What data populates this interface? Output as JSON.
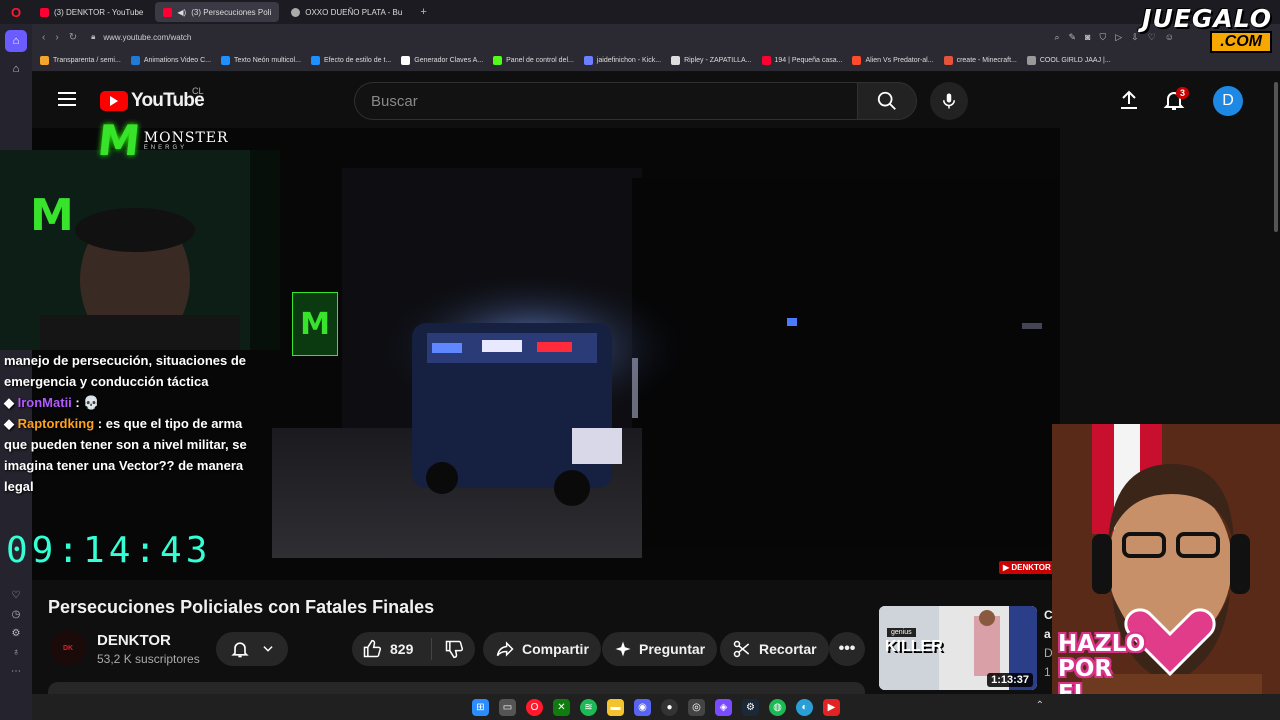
{
  "browser": {
    "tabs": [
      {
        "label": "(3) DENKTOR - YouTube",
        "active": false
      },
      {
        "label": "(3) Persecuciones Poli",
        "active": true
      },
      {
        "label": "OXXO DUEÑO PLATA - Bu",
        "active": false
      }
    ],
    "new_tab": "+",
    "url": "www.youtube.com/watch",
    "bookmarks": [
      {
        "label": "Transparenta / semi...",
        "color": "#f4a52b"
      },
      {
        "label": "Animations Video C...",
        "color": "#1e7bd6"
      },
      {
        "label": "Texto Neón multicol...",
        "color": "#1e90ff"
      },
      {
        "label": "Efecto de estilo de t...",
        "color": "#1e90ff"
      },
      {
        "label": "Generador Claves A...",
        "color": "#ffffff"
      },
      {
        "label": "Panel de control del...",
        "color": "#53fc18"
      },
      {
        "label": "jaidefinichon - Kick...",
        "color": "#6b7fff"
      },
      {
        "label": "Ripley - ZAPATILLA...",
        "color": "#dddddd"
      },
      {
        "label": "194 | Pequeña casa...",
        "color": "#ff0033"
      },
      {
        "label": "Alien Vs Predator-al...",
        "color": "#ff4a2b"
      },
      {
        "label": "create - Minecraft...",
        "color": "#e5533a"
      },
      {
        "label": "COOL GIRLD JAAJ |...",
        "color": "#999999"
      }
    ]
  },
  "watermark": {
    "top": "JUEGALO",
    "bottom": ".COM"
  },
  "youtube": {
    "logo_text": "YouTube",
    "country": "CL",
    "search_placeholder": "Buscar",
    "notifications_count": "3",
    "avatar_letter": "D"
  },
  "stream": {
    "sponsor_name": "MONSTER",
    "sponsor_sub": "ENERGY",
    "chat": {
      "line1": "manejo de persecución, situaciones de emergencia y conducción táctica",
      "msg2_user": "IronMatii",
      "msg2_text": " : 💀",
      "msg3_user": "Raptordking",
      "msg3_text": " : es que el tipo de arma que pueden tener son a nivel militar, se imagina tener una Vector?? de manera legal"
    },
    "timer": "09:14:43",
    "channel_watermark": "DENKTOR",
    "cta": [
      "HAZLO",
      "POR",
      "EL"
    ]
  },
  "video": {
    "title": "Persecuciones Policiales con Fatales Finales",
    "channel": "DENKTOR",
    "subscribers": "53,2 K suscriptores",
    "likes": "829",
    "share_label": "Compartir",
    "ask_label": "Preguntar",
    "clip_label": "Recortar"
  },
  "recommendation": {
    "duration": "1:13:37",
    "thumb_tag": "genius",
    "thumb_text": "KILLER",
    "side_text": [
      "C",
      "a",
      "D",
      "1"
    ]
  },
  "colors": {
    "youtube_red": "#ff0000",
    "timer": "#35ffd5",
    "monster_green": "#37e32b",
    "avatar_blue": "#1e88e5"
  }
}
